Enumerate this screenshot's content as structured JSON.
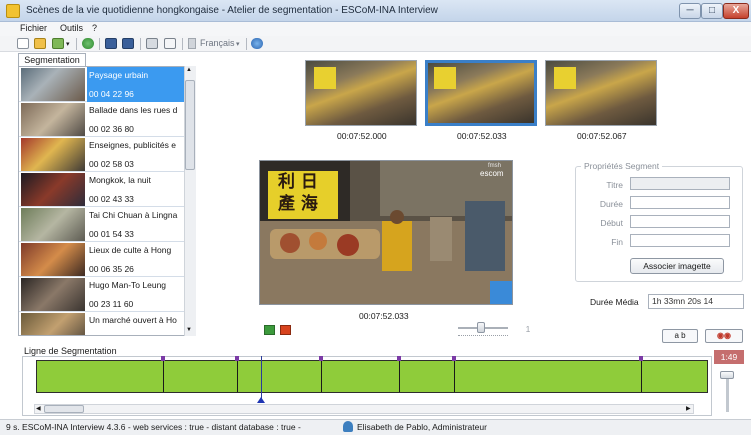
{
  "window": {
    "title": "Scènes de la vie quotidienne hongkongaise - Atelier de segmentation - ESCoM-INA Interview"
  },
  "window_buttons": {
    "minimize": "─",
    "maximize": "□",
    "close": "X"
  },
  "menu": [
    "Fichier",
    "Outils",
    "?"
  ],
  "toolbar": {
    "language": "Français"
  },
  "tabs": {
    "segmentation": "Segmentation"
  },
  "segments": [
    {
      "title": "Paysage urbain",
      "time": "00 04 22 96"
    },
    {
      "title": "Ballade dans les rues d",
      "time": "00 02 36 80"
    },
    {
      "title": "Enseignes, publicités e",
      "time": "00 02 58 03"
    },
    {
      "title": "Mongkok, la nuit",
      "time": "00 02 43 33"
    },
    {
      "title": "Tai Chi Chuan à Lingna",
      "time": "00 01 54 33"
    },
    {
      "title": "Lieux de culte à Hong",
      "time": "00 06 35 26"
    },
    {
      "title": "Hugo Man-To Leung",
      "time": "00 23 11 60"
    },
    {
      "title": "Un marché ouvert à Ho",
      "time": ""
    }
  ],
  "frames": [
    {
      "time": "00:07:52.000"
    },
    {
      "time": "00:07:52.033"
    },
    {
      "time": "00:07:52.067"
    }
  ],
  "video": {
    "time": "00:07:52.033",
    "watermark_top": "fmsh",
    "watermark_bottom": "escom",
    "sign_chars": "利 日\n產 海"
  },
  "properties": {
    "legend": "Propriétés Segment",
    "titre_label": "Titre",
    "duree_label": "Durée",
    "debut_label": "Début",
    "fin_label": "Fin",
    "assoc_button": "Associer imagette"
  },
  "media": {
    "duree_label": "Durée Média",
    "duree_value": "1h 33mn 20s 14"
  },
  "playback": {
    "spin_value": "1",
    "ab_button": "a  b"
  },
  "timeline": {
    "title": "Ligne de Segmentation",
    "zoom": "1:49",
    "bar_color": "#8fcc3a",
    "marker_color": "#7b3aa6",
    "divisions": [
      0.188,
      0.298,
      0.424,
      0.541,
      0.622,
      0.902
    ]
  },
  "statusbar": {
    "text": "9 s.  ESCoM-INA Interview 4.3.6  - web services : true -  distant database : true -",
    "user": "Elisabeth de Pablo, Administrateur"
  }
}
